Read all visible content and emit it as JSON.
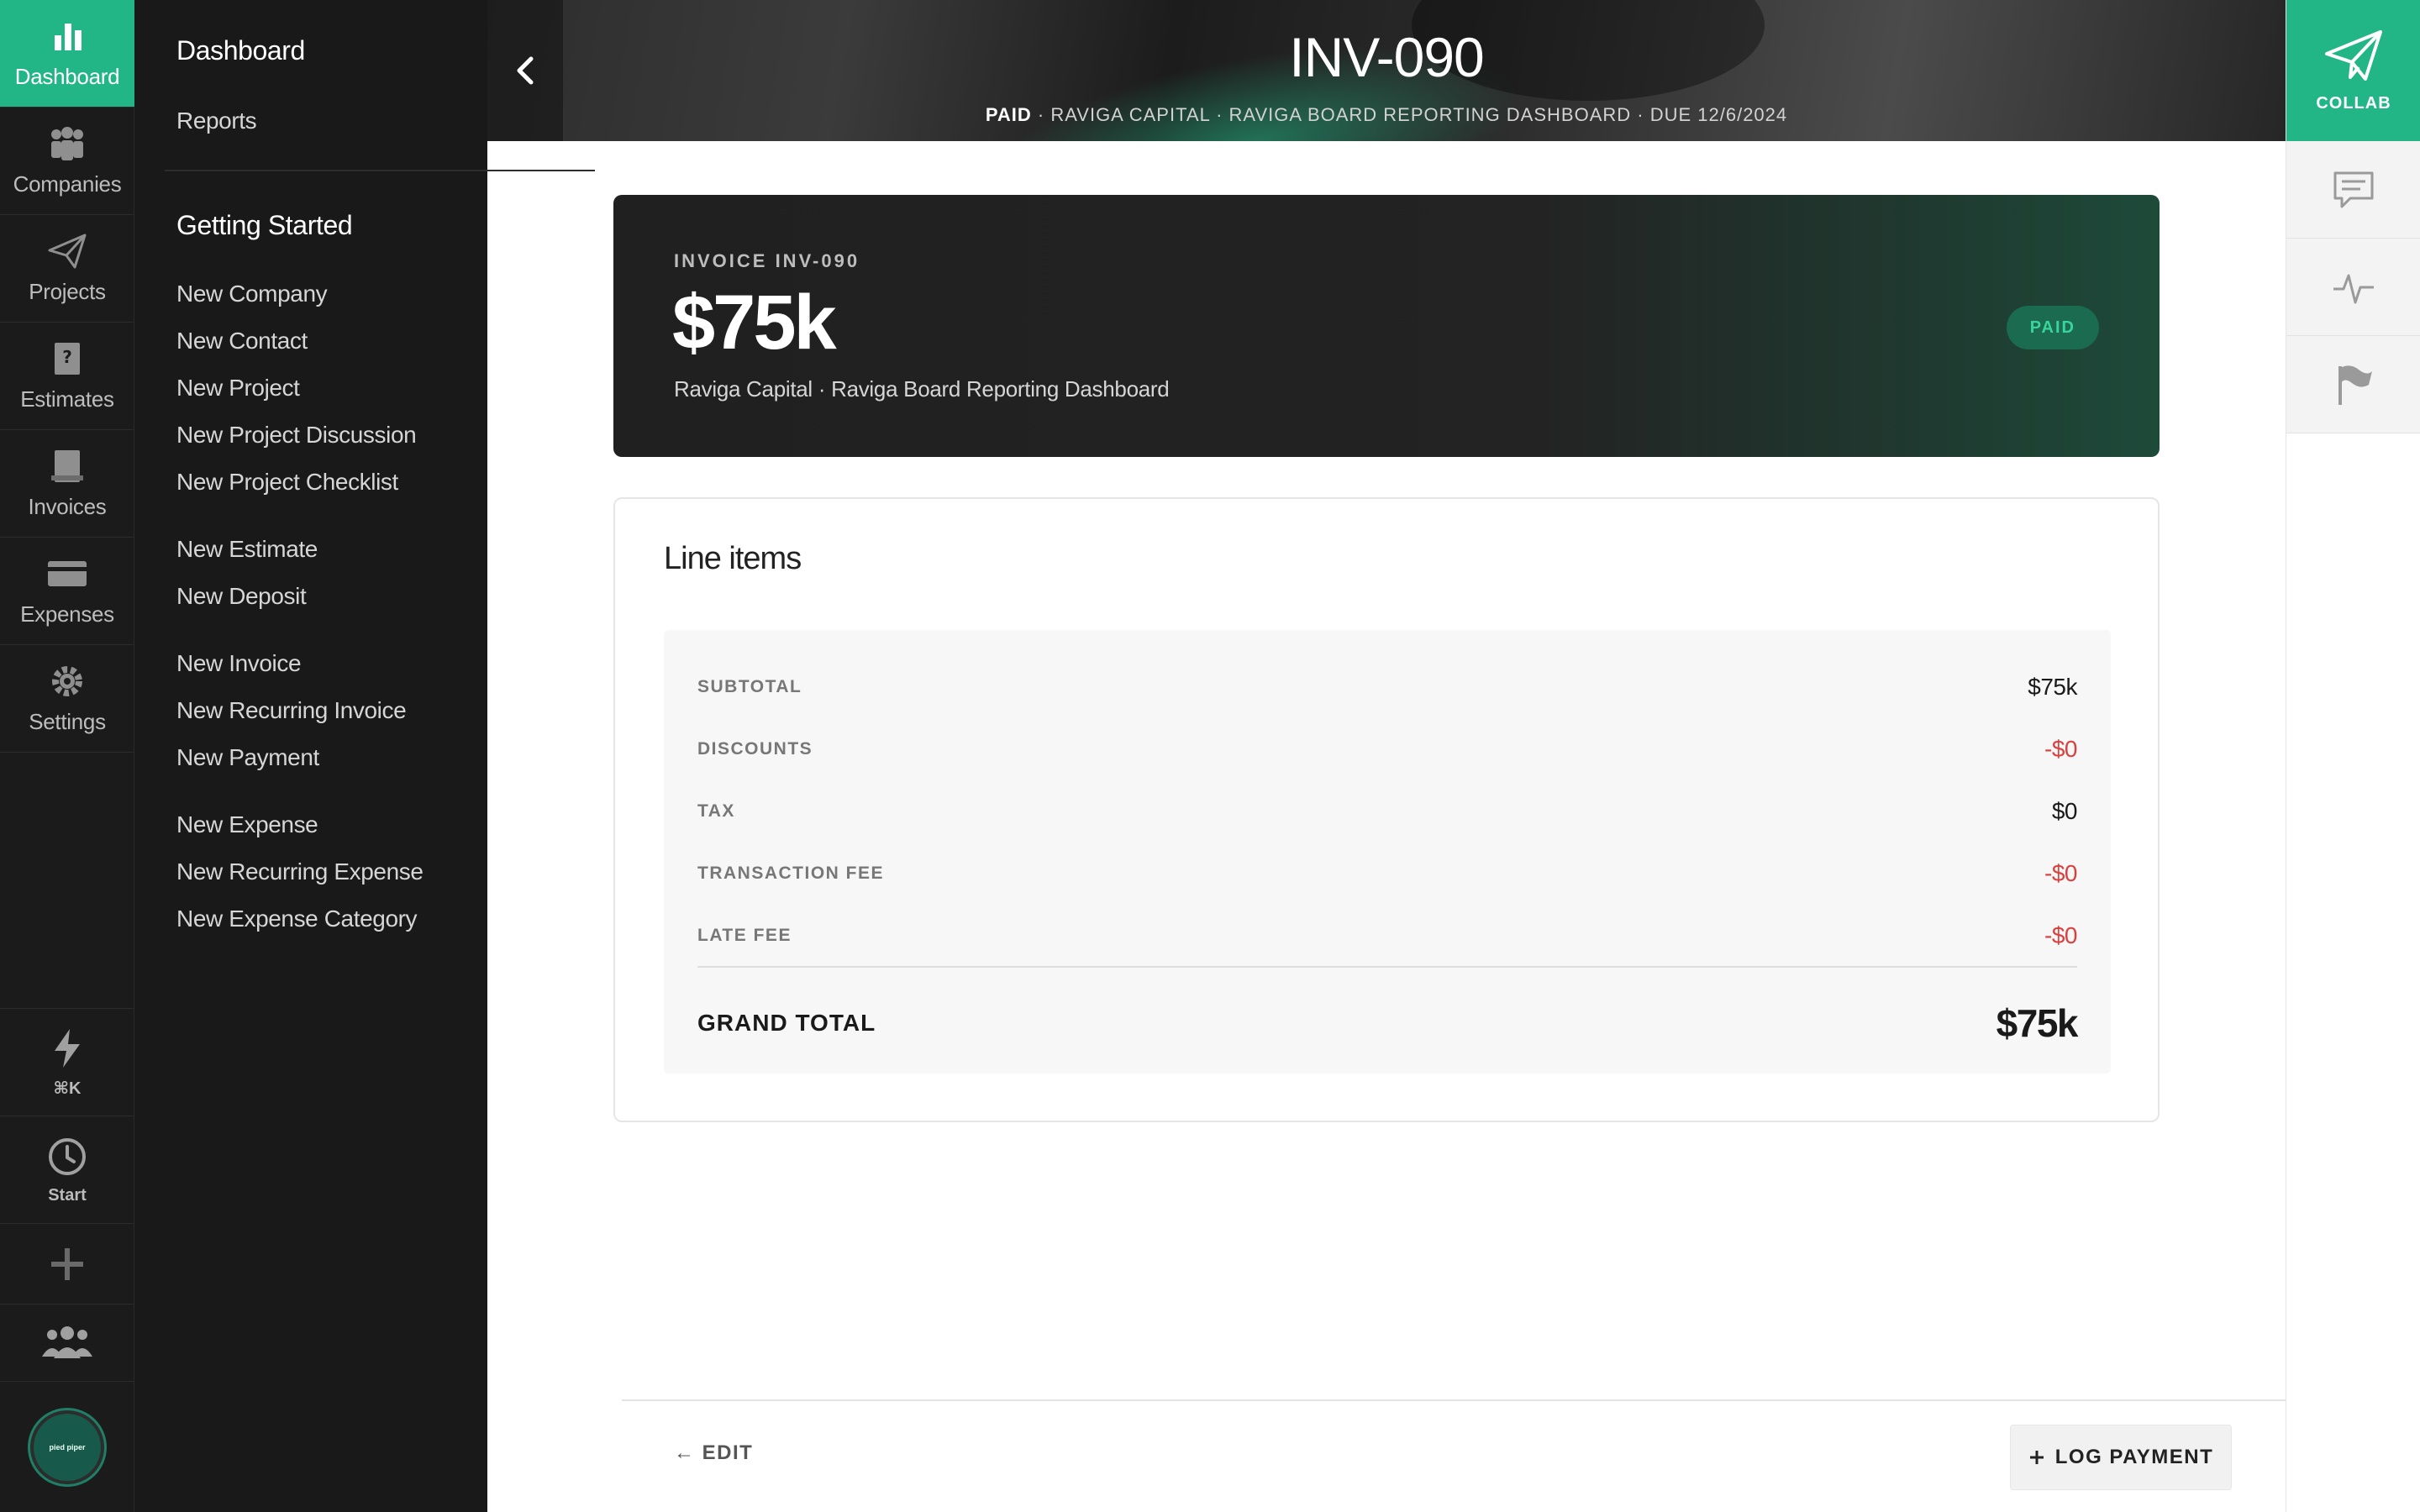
{
  "rail": {
    "items": [
      {
        "label": "Dashboard",
        "icon": "bar-chart-icon",
        "active": true
      },
      {
        "label": "Companies",
        "icon": "people-icon"
      },
      {
        "label": "Projects",
        "icon": "paper-plane-icon"
      },
      {
        "label": "Estimates",
        "icon": "estimate-icon"
      },
      {
        "label": "Invoices",
        "icon": "invoice-icon"
      },
      {
        "label": "Expenses",
        "icon": "credit-card-icon"
      },
      {
        "label": "Settings",
        "icon": "gear-icon"
      }
    ],
    "bottom": {
      "quick_label": "⌘K",
      "start_label": "Start",
      "avatar_text": "pied piper"
    }
  },
  "menu": {
    "dashboard": "Dashboard",
    "reports": "Reports",
    "getting_started": "Getting Started",
    "group1": [
      "New Company",
      "New Contact",
      "New Project",
      "New Project Discussion",
      "New Project Checklist"
    ],
    "group2": [
      "New Estimate",
      "New Deposit"
    ],
    "group3": [
      "New Invoice",
      "New Recurring Invoice",
      "New Payment"
    ],
    "group4": [
      "New Expense",
      "New Recurring Expense",
      "New Expense Category"
    ]
  },
  "header": {
    "title": "INV-090",
    "status": "PAID",
    "subtitle_rest": " · RAVIGA CAPITAL · RAVIGA BOARD REPORTING DASHBOARD · DUE 12/6/2024"
  },
  "collab": {
    "label": "COLLAB"
  },
  "hero": {
    "label": "INVOICE INV-090",
    "amount": "$75k",
    "description": "Raviga Capital · Raviga Board Reporting Dashboard",
    "badge": "PAID"
  },
  "line_items": {
    "title": "Line items",
    "rows": [
      {
        "label": "SUBTOTAL",
        "value": "$75k"
      },
      {
        "label": "DISCOUNTS",
        "value": "-$0"
      },
      {
        "label": "TAX",
        "value": "$0"
      },
      {
        "label": "TRANSACTION FEE",
        "value": "-$0"
      },
      {
        "label": "LATE FEE",
        "value": "-$0"
      }
    ],
    "total_label": "GRAND TOTAL",
    "total_value": "$75k"
  },
  "footer": {
    "edit_label": "← EDIT",
    "log_payment_label": "LOG PAYMENT"
  },
  "colors": {
    "accent": "#22b585",
    "negative": "#d9413e",
    "sidebar": "#1b1b1b"
  }
}
